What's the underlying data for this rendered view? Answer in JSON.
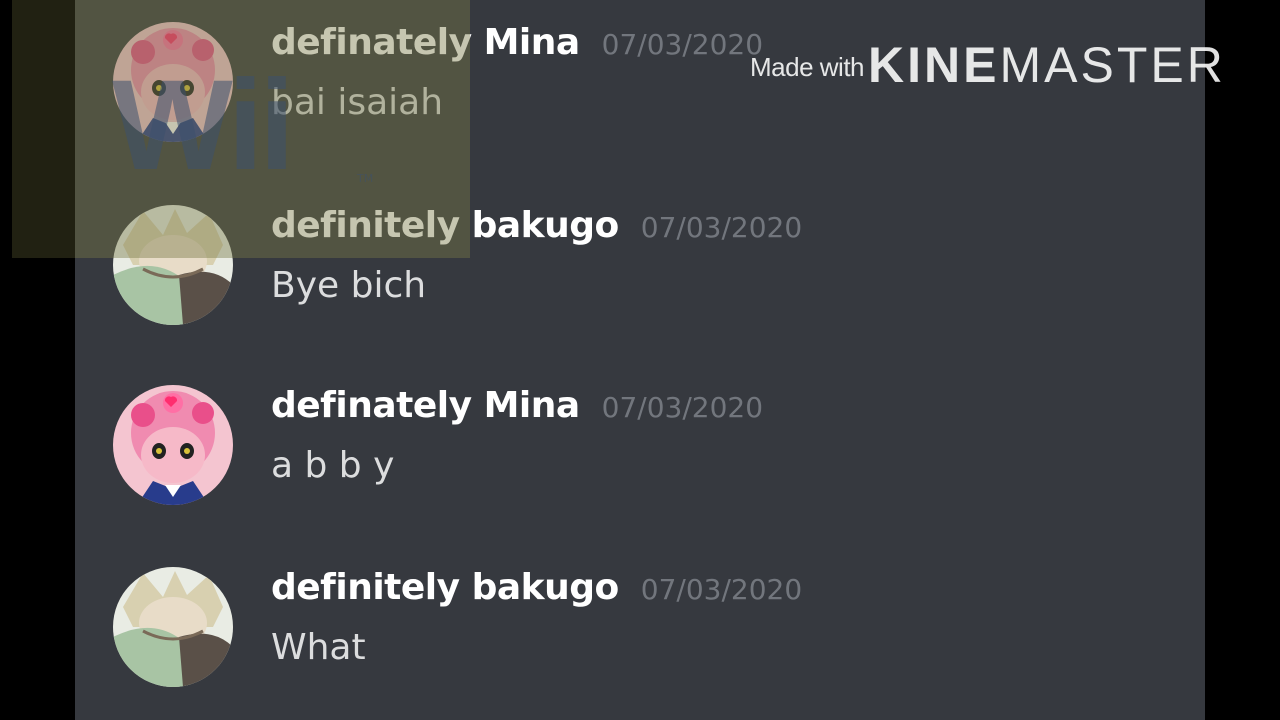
{
  "watermark": {
    "made_with": "Made with",
    "brand_bold": "KINE",
    "brand_light": "MASTER"
  },
  "overlay": {
    "text": "Wii",
    "tm": "TM"
  },
  "messages": [
    {
      "username": "definately Mina",
      "timestamp": "07/03/2020",
      "text": "bai isaiah",
      "avatar": "mina-avatar"
    },
    {
      "username": "definitely bakugo",
      "timestamp": "07/03/2020",
      "text": "Bye bich",
      "avatar": "bakugo-avatar"
    },
    {
      "username": "definately Mina",
      "timestamp": "07/03/2020",
      "text": "a b b y",
      "avatar": "mina-avatar"
    },
    {
      "username": "definitely bakugo",
      "timestamp": "07/03/2020",
      "text": "What",
      "avatar": "bakugo-avatar"
    }
  ],
  "colors": {
    "chat_background": "#36393f",
    "username": "#ffffff",
    "timestamp": "#72767d",
    "message_text": "#dcddde",
    "side_bars": "#000000"
  }
}
